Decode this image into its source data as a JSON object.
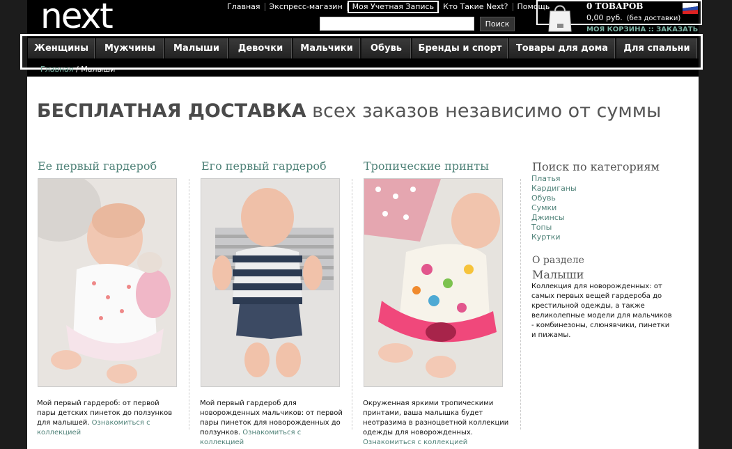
{
  "header": {
    "logo": "next",
    "top_links": [
      "Главная",
      "Экспресс-магазин",
      "Моя Учетная Запись",
      "Кто Такие Next?",
      "Помощь"
    ],
    "search_placeholder": "",
    "search_button": "Поиск"
  },
  "basket": {
    "count": "0 ТОВАРОВ",
    "price": "0,00 руб.",
    "delivery_note": "(без доставки)",
    "link": "МОЯ КОРЗИНА :: ЗАКАЗАТЬ"
  },
  "nav": {
    "items": [
      "Женщины",
      "Мужчины",
      "Малыши",
      "Девочки",
      "Мальчики",
      "Обувь",
      "Бренды и спорт",
      "Товары для дома",
      "Для спальни"
    ]
  },
  "breadcrumb": {
    "home": "Главная",
    "separator": "/",
    "current": "Малыши"
  },
  "banner": {
    "bold": "БЕСПЛАТНАЯ ДОСТАВКА",
    "rest": "всех заказов независимо от суммы"
  },
  "columns": [
    {
      "title": "Ее первый гардероб",
      "text": "Мой первый гардероб: от первой пары детских пинеток до ползунков для малышей.",
      "link": "Ознакомиться с коллекцией"
    },
    {
      "title": "Его первый гардероб",
      "text": "Мой первый гардероб для новорожденных мальчиков: от первой пары пинеток для новорожденных до ползунков.",
      "link": "Ознакомиться с коллекцией"
    },
    {
      "title": "Тропические принты",
      "text": "Окруженная яркими тропическими принтами, ваша малышка будет неотразима в разноцветной коллекции одежды для новорожденных.",
      "link": "Ознакомиться с коллекцией"
    }
  ],
  "sidebar": {
    "title": "Поиск по категориям",
    "categories": [
      "Платья",
      "Кардиганы",
      "Обувь",
      "Сумки",
      "Джинсы",
      "Топы",
      "Куртки"
    ],
    "about_prefix": "О разделе",
    "about_title": "Малыши",
    "about_text": "Коллекция для новорожденных: от самых первых вещей гардероба до крестильной одежды, а также великолепные модели для мальчиков - комбинезоны, слюнявчики, пинетки и пижамы."
  },
  "colors": {
    "accent": "#4f8278",
    "nav_bg": "#2b2b2b",
    "page_bg": "#1c1c1c"
  }
}
